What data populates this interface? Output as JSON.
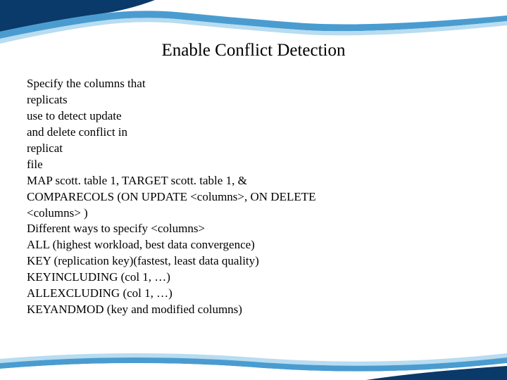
{
  "title": "Enable Conflict Detection",
  "lines": {
    "l1": "Specify the columns that",
    "l2": "replicats",
    "l3": "use to detect update",
    "l4": "and delete conflict in",
    "l5": "replicat",
    "l6": "file",
    "l7": "MAP scott. table 1, TARGET scott. table 1, &",
    "l8": "COMPARECOLS (ON UPDATE <columns>, ON DELETE",
    "l9": "<columns>  )",
    "l10": "Different ways to specify <columns>",
    "l11": "ALL (highest workload, best data convergence)",
    "l12": "KEY (replication key)(fastest, least data quality)",
    "l13": "KEYINCLUDING (col 1, …)",
    "l14": "ALLEXCLUDING (col 1, …)",
    "l15": "KEYANDMOD (key and modified columns)"
  },
  "colors": {
    "waveDark": "#0a3a6a",
    "waveMid": "#3b8bc4",
    "waveLight": "#a8d0e8"
  }
}
